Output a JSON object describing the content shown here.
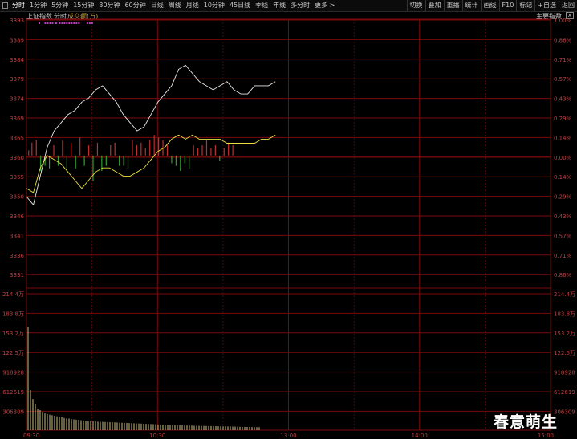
{
  "toolbar": {
    "tabs": [
      "分时",
      "1分钟",
      "5分钟",
      "15分钟",
      "30分钟",
      "60分钟",
      "日线",
      "周线",
      "月线",
      "10分钟",
      "45日线",
      "季线",
      "年线",
      "多分时",
      "更多 >"
    ],
    "buttons": [
      "切换",
      "叠加",
      "重播",
      "统计",
      "画线",
      "F10",
      "标记",
      "+自选",
      "返回"
    ]
  },
  "header": {
    "index_name": "上证指数",
    "view": "分时",
    "volume_label": "成交额(万)",
    "index_button": "主要指数",
    "close_symbol": "x"
  },
  "chart_data": {
    "type": "line",
    "price": {
      "left_ticks": [
        "3393",
        "3389",
        "3384",
        "3379",
        "3374",
        "3369",
        "3365",
        "3360",
        "3355",
        "3350",
        "3346",
        "3341",
        "3336",
        "3331"
      ],
      "right_ticks": [
        "1.00%",
        "0.86%",
        "0.71%",
        "0.57%",
        "0.43%",
        "0.29%",
        "0.14%",
        "0.00%",
        "0.14%",
        "0.29%",
        "0.43%",
        "0.57%",
        "0.71%",
        "0.86%"
      ],
      "ylim": [
        3331,
        3393
      ],
      "base": 3360,
      "series": [
        {
          "name": "",
          "color": "#e8e8e8",
          "values": [
            3350,
            3348,
            3355,
            3362,
            3366,
            3368,
            3370,
            3371,
            3373,
            3374,
            3376,
            3377,
            3375,
            3373,
            3370,
            3368,
            3366,
            3367,
            3370,
            3373,
            3375,
            3377,
            3381,
            3382,
            3380,
            3378,
            3377,
            3376,
            3377,
            3378,
            3376,
            3375,
            3375,
            3377,
            3377,
            3377,
            3378
          ]
        },
        {
          "name": "",
          "color": "#e8e040",
          "values": [
            3352,
            3351,
            3357,
            3360,
            3359,
            3358,
            3356,
            3354,
            3352,
            3354,
            3356,
            3357,
            3357,
            3356,
            3355,
            3355,
            3356,
            3357,
            3359,
            3361,
            3362,
            3364,
            3365,
            3364,
            3365,
            3364,
            3364,
            3364,
            3364,
            3363,
            3363,
            3363,
            3363,
            3363,
            3364,
            3364,
            3365
          ]
        }
      ],
      "histogram": [
        {
          "t": 1,
          "v": 2
        },
        {
          "t": 4,
          "v": 5
        },
        {
          "t": 8,
          "v": 6
        },
        {
          "t": 12,
          "v": -6
        },
        {
          "t": 16,
          "v": -4
        },
        {
          "t": 20,
          "v": -5
        },
        {
          "t": 24,
          "v": 4
        },
        {
          "t": 28,
          "v": -4
        },
        {
          "t": 32,
          "v": 6
        },
        {
          "t": 36,
          "v": -6
        },
        {
          "t": 40,
          "v": 5
        },
        {
          "t": 44,
          "v": -5
        },
        {
          "t": 48,
          "v": 7
        },
        {
          "t": 52,
          "v": -4
        },
        {
          "t": 56,
          "v": 4
        },
        {
          "t": 60,
          "v": -10
        },
        {
          "t": 64,
          "v": 5
        },
        {
          "t": 68,
          "v": -6
        },
        {
          "t": 72,
          "v": -4
        },
        {
          "t": 76,
          "v": 4
        },
        {
          "t": 80,
          "v": 5
        },
        {
          "t": 84,
          "v": -4
        },
        {
          "t": 88,
          "v": -4
        },
        {
          "t": 92,
          "v": -5
        },
        {
          "t": 96,
          "v": 6
        },
        {
          "t": 100,
          "v": 4
        },
        {
          "t": 104,
          "v": 5
        },
        {
          "t": 108,
          "v": 3
        },
        {
          "t": 112,
          "v": 6
        },
        {
          "t": 116,
          "v": 8
        },
        {
          "t": 120,
          "v": 7
        },
        {
          "t": 124,
          "v": 6
        },
        {
          "t": 128,
          "v": 4
        },
        {
          "t": 132,
          "v": -3
        },
        {
          "t": 136,
          "v": -4
        },
        {
          "t": 140,
          "v": -6
        },
        {
          "t": 144,
          "v": -3
        },
        {
          "t": 148,
          "v": -5
        },
        {
          "t": 152,
          "v": 4
        },
        {
          "t": 156,
          "v": 3
        },
        {
          "t": 160,
          "v": 4
        },
        {
          "t": 164,
          "v": 6
        },
        {
          "t": 168,
          "v": 3
        },
        {
          "t": 172,
          "v": 4
        },
        {
          "t": 176,
          "v": -2
        },
        {
          "t": 180,
          "v": 3
        },
        {
          "t": 184,
          "v": 5
        },
        {
          "t": 188,
          "v": 4
        }
      ],
      "purple_markers": [
        2,
        7,
        9,
        11,
        13,
        16,
        19,
        21,
        23,
        25,
        27,
        29,
        31,
        33,
        35,
        42,
        44,
        46
      ]
    },
    "volume": {
      "left_ticks": [
        "214.4万",
        "183.8万",
        "153.2万",
        "122.5万",
        "918928",
        "612619",
        "306309"
      ],
      "right_ticks": [
        "214.4万",
        "183.8万",
        "153.2万",
        "122.5万",
        "918928",
        "612619",
        "306309"
      ],
      "ylim": [
        0,
        2450000
      ],
      "values": [
        1850000,
        720000,
        560000,
        470000,
        390000,
        360000,
        330000,
        300000,
        290000,
        280000,
        270000,
        260000,
        250000,
        240000,
        230000,
        220000,
        210000,
        210000,
        200000,
        195000,
        190000,
        185000,
        180000,
        175000,
        170000,
        165000,
        160000,
        158000,
        156000,
        154000,
        152000,
        150000,
        148000,
        146000,
        144000,
        142000,
        140000,
        138000,
        136000,
        134000,
        132000,
        130000,
        128000,
        126000,
        124000,
        122000,
        120000,
        118000,
        116000,
        114000,
        112000,
        110000,
        108000,
        106000,
        104000,
        102000,
        100000,
        98000,
        96000,
        94000,
        92000,
        90000,
        90000,
        88000,
        86000,
        86000,
        84000,
        82000,
        82000,
        80000,
        80000,
        78000,
        78000,
        76000,
        76000,
        74000,
        74000,
        72000,
        72000,
        70000,
        70000,
        68000,
        68000,
        66000,
        66000,
        64000,
        64000,
        62000,
        62000,
        60000,
        60000,
        58000,
        58000,
        56000,
        56000,
        54000,
        54000
      ]
    },
    "time_ticks": [
      "09:30",
      "10:30",
      "13:00",
      "14:00",
      "15:00"
    ]
  },
  "watermark": "春意萌生",
  "colors": {
    "grid": "#7a0a0a",
    "axis_text": "#c04040",
    "price_line": "#e8e8e8",
    "avg_line": "#e8e040",
    "up_bar": "#c03030",
    "down_bar": "#30a030",
    "volume_bar": "#c8c080",
    "marker": "#c040c0"
  }
}
